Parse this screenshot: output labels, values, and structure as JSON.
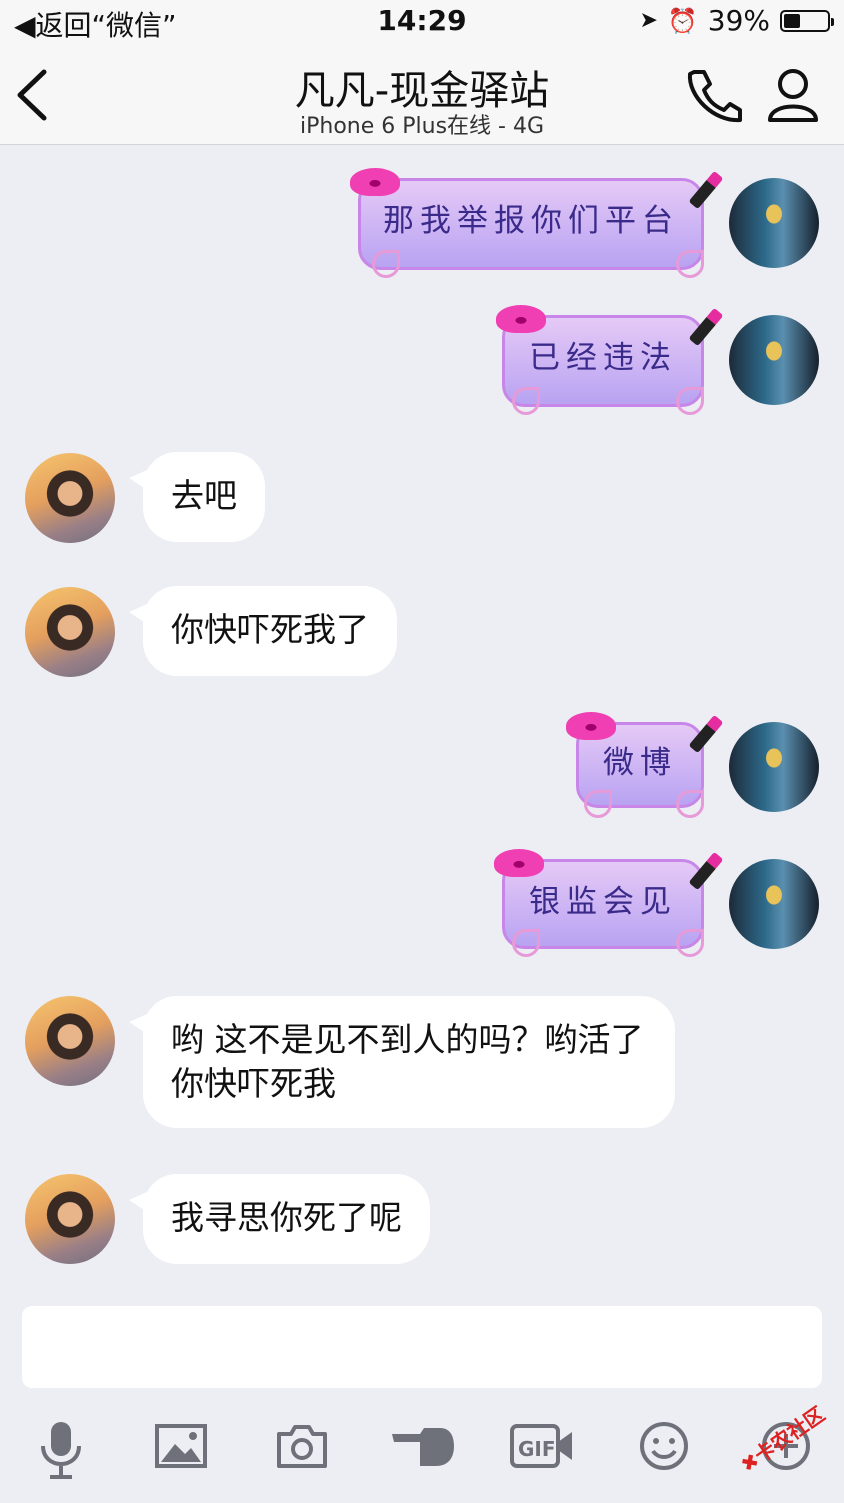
{
  "status_bar": {
    "back_app": "返回“微信”",
    "time": "14:29",
    "battery": "39%",
    "battery_level": 0.39
  },
  "header": {
    "title": "凡凡-现金驿站",
    "subtitle": "iPhone 6 Plus在线 - 4G"
  },
  "messages": [
    {
      "side": "right",
      "text": "那我举报你们平台"
    },
    {
      "side": "right",
      "text": "已经违法"
    },
    {
      "side": "left",
      "text": "去吧"
    },
    {
      "side": "left",
      "text": "你快吓死我了"
    },
    {
      "side": "right",
      "text": "微博"
    },
    {
      "side": "right",
      "text": "银监会见"
    },
    {
      "side": "left",
      "text": "哟 这不是见不到人的吗？哟活了 你快吓死我"
    },
    {
      "side": "left",
      "text": "我寻思你死了呢"
    }
  ],
  "input": {
    "value": ""
  },
  "toolbar": [
    "mic-icon",
    "image-icon",
    "camera-icon",
    "poke-icon",
    "gif-icon",
    "emoji-icon",
    "plus-icon"
  ],
  "watermark": {
    "text": "卡农社区"
  },
  "colors": {
    "bubble_purple": "#b8a3f2",
    "bubble_border": "#c786e8",
    "background": "#eceef3"
  }
}
